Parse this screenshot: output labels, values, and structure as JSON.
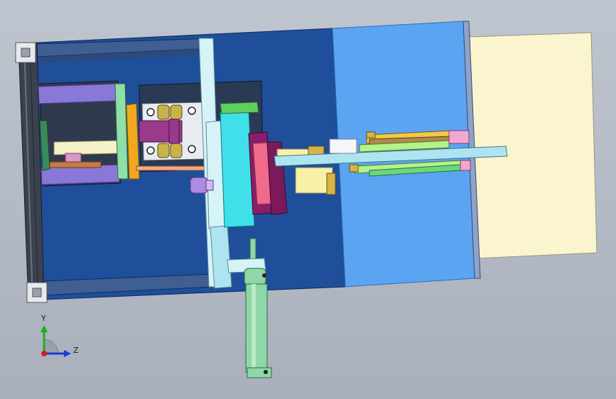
{
  "triad": {
    "y_label": "Y",
    "z_label": "Z"
  },
  "colors": {
    "background": "#b6bcc6",
    "plate_dark_blue": "#1f4f9a",
    "plate_light_blue": "#5aa4f2",
    "cream_panel": "#fbf5cf",
    "aluminum_profile": "#3c4150",
    "cylinder_green": "#8fd6a8",
    "cyan_block": "#3fe0ea",
    "pink_block": "#f06a8a",
    "magenta_block": "#8a1d6a",
    "purple_bar": "#8a78d8"
  }
}
